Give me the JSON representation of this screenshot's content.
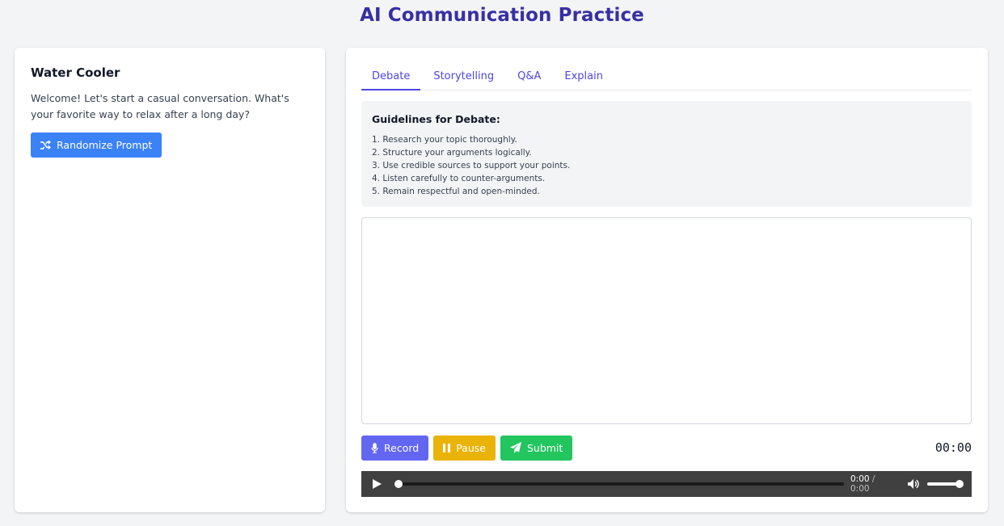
{
  "header": {
    "title": "AI Communication Practice"
  },
  "left_panel": {
    "title": "Water Cooler",
    "text": "Welcome! Let's start a casual conversation. What's your favorite way to relax after a long day?",
    "randomize_label": "Randomize Prompt"
  },
  "tabs": [
    {
      "label": "Debate",
      "active": true
    },
    {
      "label": "Storytelling",
      "active": false
    },
    {
      "label": "Q&A",
      "active": false
    },
    {
      "label": "Explain",
      "active": false
    }
  ],
  "guidelines": {
    "title": "Guidelines for Debate:",
    "items": [
      "1. Research your topic thoroughly.",
      "2. Structure your arguments logically.",
      "3. Use credible sources to support your points.",
      "4. Listen carefully to counter-arguments.",
      "5. Remain respectful and open-minded."
    ]
  },
  "response": {
    "value": ""
  },
  "controls": {
    "record_label": "Record",
    "pause_label": "Pause",
    "submit_label": "Submit",
    "timer": "00:00"
  },
  "audio": {
    "current_time": "0:00",
    "separator": "/",
    "total_time": "0:00",
    "progress": 0,
    "volume": 1
  },
  "colors": {
    "title": "#3730a3",
    "tab_accent": "#4f46e5",
    "randomize": "#3b82f6",
    "record": "#6366f1",
    "pause": "#eab308",
    "submit": "#22c55e",
    "audio_bg": "#404040"
  },
  "icons": {
    "randomize": "shuffle-icon",
    "record": "microphone-icon",
    "pause": "pause-icon",
    "submit": "paper-plane-icon",
    "play": "play-icon",
    "volume": "volume-icon"
  }
}
